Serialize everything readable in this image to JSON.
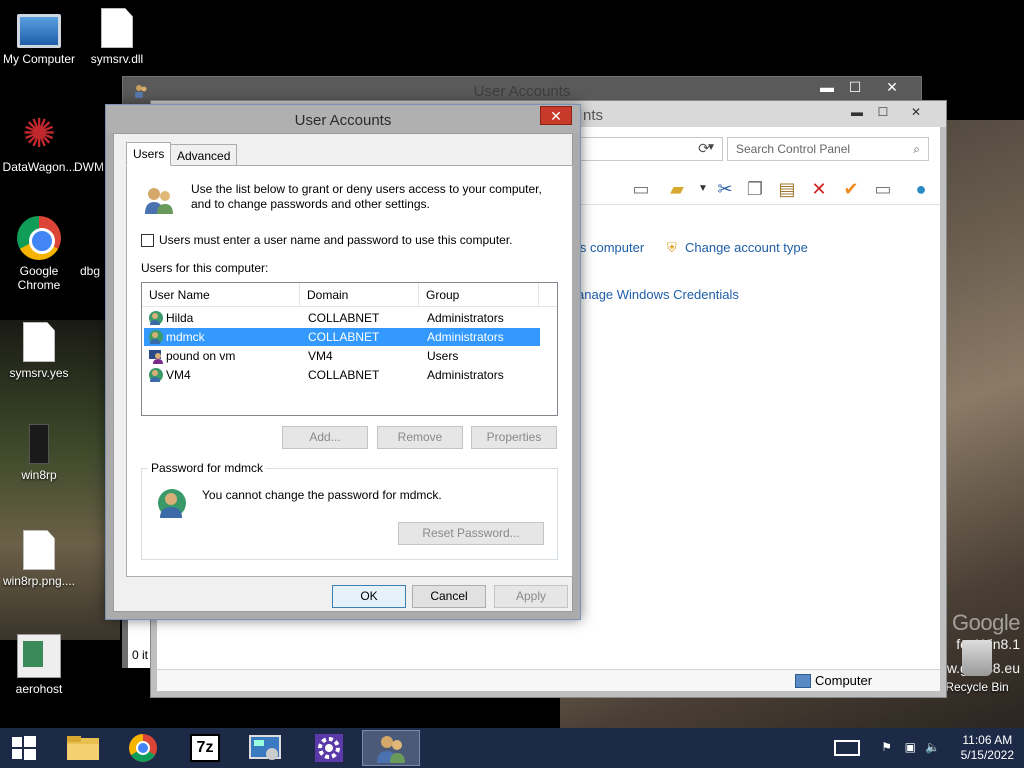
{
  "desktop": {
    "icons": [
      {
        "label": "My Computer"
      },
      {
        "label": "symsrv.dll"
      },
      {
        "label": "DataWagon..."
      },
      {
        "label": "DWM"
      },
      {
        "label": "Google Chrome"
      },
      {
        "label": "dbg"
      },
      {
        "label": "symsrv.yes"
      },
      {
        "label": "win8rp"
      },
      {
        "label": "win8rp.png...."
      },
      {
        "label": "aerohost"
      },
      {
        "label": "Recycle Bin"
      }
    ],
    "watermark": {
      "line1": "Google",
      "line2": "for Win8.1",
      "line3": "w.glass8.eu"
    }
  },
  "back_window": {
    "title": "User Accounts",
    "partial_title": "nts"
  },
  "control_panel": {
    "search_placeholder": "Search Control Panel",
    "links": {
      "this_computer": "is computer",
      "change_account_type": "Change account type",
      "credentials": "anage Windows Credentials"
    },
    "status_left": "0 it",
    "status_computer": "Computer"
  },
  "dialog": {
    "title": "User Accounts",
    "tabs": [
      {
        "label": "Users",
        "active": true
      },
      {
        "label": "Advanced",
        "active": false
      }
    ],
    "info_text_1": "Use the list below to grant or deny users access to your computer,",
    "info_text_2": "and to change passwords and other settings.",
    "require_login_label": "Users must enter a user name and password to use this computer.",
    "require_login_checked": false,
    "users_label": "Users for this computer:",
    "columns": [
      "User Name",
      "Domain",
      "Group"
    ],
    "users": [
      {
        "name": "Hilda",
        "domain": "COLLABNET",
        "group": "Administrators",
        "selected": false
      },
      {
        "name": "mdmck",
        "domain": "COLLABNET",
        "group": "Administrators",
        "selected": true
      },
      {
        "name": "pound on vm",
        "domain": "VM4",
        "group": "Users",
        "selected": false
      },
      {
        "name": "VM4",
        "domain": "COLLABNET",
        "group": "Administrators",
        "selected": false
      }
    ],
    "buttons": {
      "add": "Add...",
      "remove": "Remove",
      "properties": "Properties"
    },
    "password_group_title": "Password for mdmck",
    "password_text": "You cannot change the password for mdmck.",
    "reset_password": "Reset Password...",
    "ok": "OK",
    "cancel": "Cancel",
    "apply": "Apply"
  },
  "taskbar": {
    "time": "11:06 AM",
    "date": "5/15/2022",
    "seven_zip_label": "7z"
  },
  "colors": {
    "selection": "#3399ff",
    "close_red": "#c73a2a",
    "link_blue": "#1e5ea8",
    "taskbar": "#1c2a47"
  }
}
